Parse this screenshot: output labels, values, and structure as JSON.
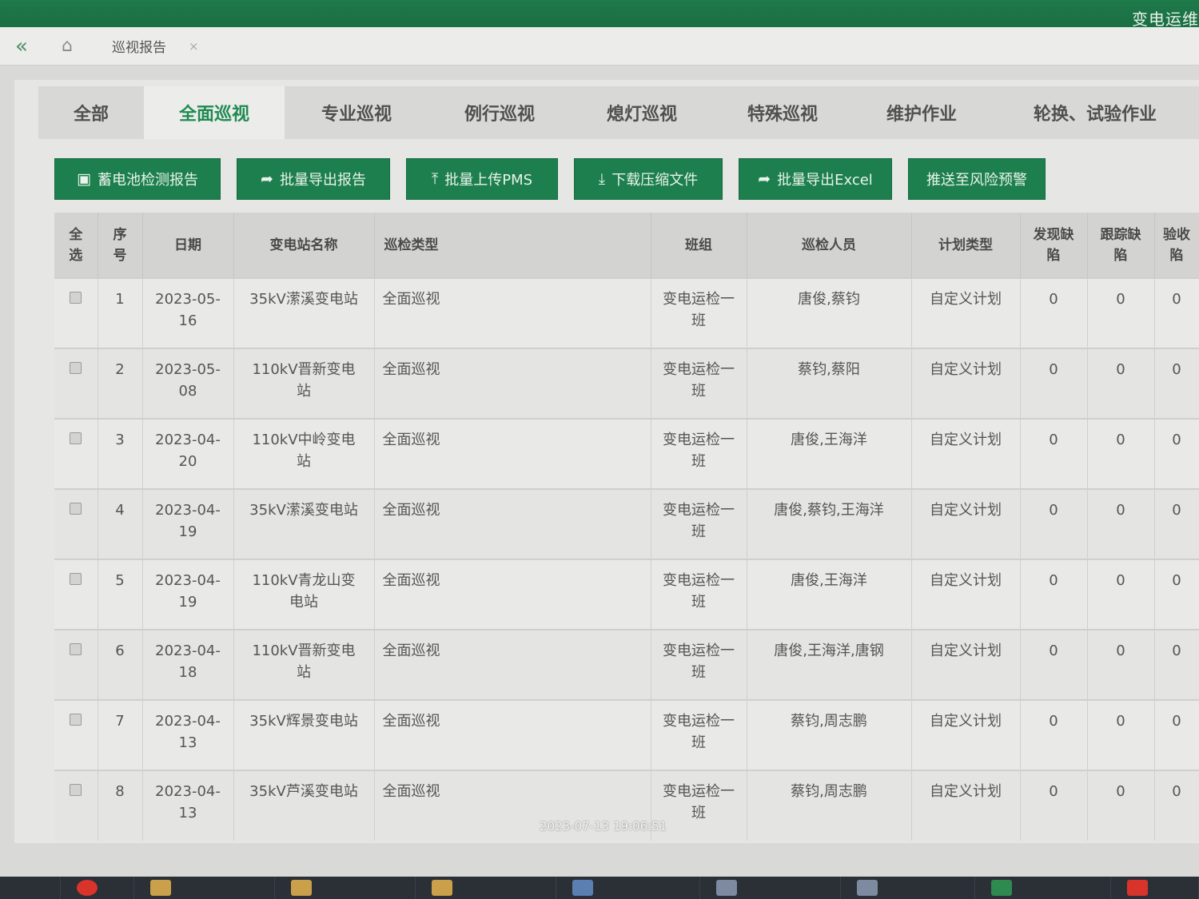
{
  "header": {
    "brand": "变电运维"
  },
  "tabbar": {
    "collapse_icon": "«",
    "home_icon": "⌂",
    "open_tab_label": "巡视报告",
    "close_icon": "×"
  },
  "categories": [
    {
      "label": "全部"
    },
    {
      "label": "全面巡视"
    },
    {
      "label": "专业巡视"
    },
    {
      "label": "例行巡视"
    },
    {
      "label": "熄灯巡视"
    },
    {
      "label": "特殊巡视"
    },
    {
      "label": "维护作业"
    },
    {
      "label": "轮换、试验作业"
    }
  ],
  "toolbar": {
    "battery_report": {
      "label": "蓄电池检测报告",
      "icon": "▣"
    },
    "export_report": {
      "label": "批量导出报告",
      "icon": "➦"
    },
    "upload_pms": {
      "label": "批量上传PMS",
      "icon": "⤒"
    },
    "download_zip": {
      "label": "下载压缩文件",
      "icon": "⤓"
    },
    "export_excel": {
      "label": "批量导出Excel",
      "icon": "➦"
    },
    "push_risk": {
      "label": "推送至风险预警"
    }
  },
  "table": {
    "headers": {
      "select": "全\n选",
      "seq": "序\n号",
      "date": "日期",
      "station": "变电站名称",
      "type": "巡检类型",
      "team": "班组",
      "staff": "巡检人员",
      "plan": "计划类型",
      "found": "发现缺\n陷",
      "tracked": "跟踪缺\n陷",
      "accepted": "验收\n陷"
    },
    "rows": [
      {
        "seq": "1",
        "date": "2023-05-\n16",
        "station": "35kV潆溪变电站",
        "type": "全面巡视",
        "team": "变电运检一\n班",
        "staff": "唐俊,蔡钧",
        "plan": "自定义计划",
        "found": "0",
        "tracked": "0",
        "accepted": "0"
      },
      {
        "seq": "2",
        "date": "2023-05-\n08",
        "station": "110kV晋新变电\n站",
        "type": "全面巡视",
        "team": "变电运检一\n班",
        "staff": "蔡钧,蔡阳",
        "plan": "自定义计划",
        "found": "0",
        "tracked": "0",
        "accepted": "0"
      },
      {
        "seq": "3",
        "date": "2023-04-\n20",
        "station": "110kV中岭变电\n站",
        "type": "全面巡视",
        "team": "变电运检一\n班",
        "staff": "唐俊,王海洋",
        "plan": "自定义计划",
        "found": "0",
        "tracked": "0",
        "accepted": "0"
      },
      {
        "seq": "4",
        "date": "2023-04-\n19",
        "station": "35kV潆溪变电站",
        "type": "全面巡视",
        "team": "变电运检一\n班",
        "staff": "唐俊,蔡钧,王海洋",
        "plan": "自定义计划",
        "found": "0",
        "tracked": "0",
        "accepted": "0"
      },
      {
        "seq": "5",
        "date": "2023-04-\n19",
        "station": "110kV青龙山变\n电站",
        "type": "全面巡视",
        "team": "变电运检一\n班",
        "staff": "唐俊,王海洋",
        "plan": "自定义计划",
        "found": "0",
        "tracked": "0",
        "accepted": "0"
      },
      {
        "seq": "6",
        "date": "2023-04-\n18",
        "station": "110kV晋新变电\n站",
        "type": "全面巡视",
        "team": "变电运检一\n班",
        "staff": "唐俊,王海洋,唐钢",
        "plan": "自定义计划",
        "found": "0",
        "tracked": "0",
        "accepted": "0"
      },
      {
        "seq": "7",
        "date": "2023-04-\n13",
        "station": "35kV辉景变电站",
        "type": "全面巡视",
        "team": "变电运检一\n班",
        "staff": "蔡钧,周志鹏",
        "plan": "自定义计划",
        "found": "0",
        "tracked": "0",
        "accepted": "0"
      },
      {
        "seq": "8",
        "date": "2023-04-\n13",
        "station": "35kV芦溪变电站",
        "type": "全面巡视",
        "team": "变电运检一\n班",
        "staff": "蔡钧,周志鹏",
        "plan": "自定义计划",
        "found": "0",
        "tracked": "0",
        "accepted": "0"
      }
    ]
  },
  "timestamp": "2023-07-13 19:06:51",
  "taskbar": {
    "items": [
      {
        "label": "",
        "color": "#d9342b"
      },
      {
        "label": "",
        "color": "#caa04a"
      },
      {
        "label": "",
        "color": "#caa04a"
      },
      {
        "label": "",
        "color": "#caa04a"
      },
      {
        "label": "",
        "color": "#5a7fb0"
      },
      {
        "label": "",
        "color": "#7d8aa0"
      },
      {
        "label": "",
        "color": "#7d8aa0"
      },
      {
        "label": "",
        "color": "#2f8a4f"
      },
      {
        "label": "",
        "color": "#d9342b"
      }
    ]
  }
}
